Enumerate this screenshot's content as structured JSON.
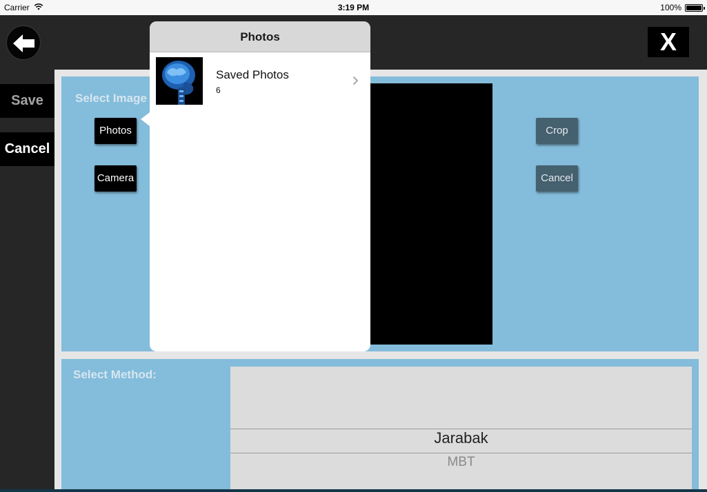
{
  "status_bar": {
    "carrier": "Carrier",
    "time": "3:19 PM",
    "battery": "100%",
    "battery_level": 1.0
  },
  "header": {
    "back_icon": "arrow-left-icon",
    "close_label": "X"
  },
  "sidebar": {
    "save_label": "Save",
    "cancel_label": "Cancel"
  },
  "image_panel": {
    "label": "Select Image",
    "photos_button": "Photos",
    "camera_button": "Camera",
    "crop_button": "Crop",
    "cancel_button": "Cancel"
  },
  "method_panel": {
    "label": "Select Method:",
    "picker": {
      "selected": "Jarabak",
      "next": "MBT"
    }
  },
  "popover": {
    "title": "Photos",
    "albums": [
      {
        "name": "Saved Photos",
        "count": "6",
        "thumbnail_icon": "skull-xray-thumbnail"
      }
    ],
    "chevron_icon": "chevron-right-icon"
  }
}
